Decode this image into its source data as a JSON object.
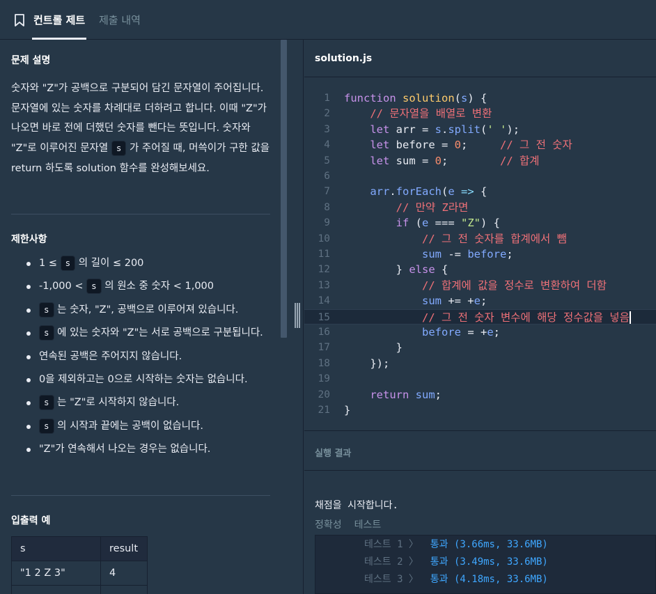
{
  "header": {
    "tab_active": "컨트롤 제트",
    "tab_inactive": "제출 내역"
  },
  "problem": {
    "title": "문제 설명",
    "desc_parts": [
      "숫자와 \"Z\"가 공백으로 구분되어 담긴 문자열이 주어집니다. 문자열에 있는 숫자를 차례대로 더하려고 합니다. 이때 \"Z\"가 나오면 바로 전에 더했던 숫자를 뺀다는 뜻입니다. 숫자와 \"Z\"로 이루어진 문자열 ",
      "s",
      " 가 주어질 때, 머쓱이가 구한 값을 return 하도록 solution 함수를 완성해보세요."
    ]
  },
  "constraints": {
    "title": "제한사항",
    "items": [
      {
        "pre": "1 ≤ ",
        "code": "s",
        "post": " 의 길이 ≤ 200"
      },
      {
        "pre": "-1,000 < ",
        "code": "s",
        "post": " 의 원소 중 숫자 < 1,000"
      },
      {
        "pre": "",
        "code": "s",
        "post": " 는 숫자, \"Z\", 공백으로 이루어져 있습니다."
      },
      {
        "pre": "",
        "code": "s",
        "post": " 에 있는 숫자와 \"Z\"는 서로 공백으로 구분됩니다."
      },
      {
        "pre": "연속된 공백은 주어지지 않습니다.",
        "code": "",
        "post": ""
      },
      {
        "pre": "0을 제외하고는 0으로 시작하는 숫자는 없습니다.",
        "code": "",
        "post": ""
      },
      {
        "pre": "",
        "code": "s",
        "post": " 는 \"Z\"로 시작하지 않습니다."
      },
      {
        "pre": "",
        "code": "s",
        "post": " 의 시작과 끝에는 공백이 없습니다."
      },
      {
        "pre": "\"Z\"가 연속해서 나오는 경우는 없습니다.",
        "code": "",
        "post": ""
      }
    ]
  },
  "io": {
    "title": "입출력 예",
    "headers": [
      "s",
      "result"
    ],
    "rows": [
      [
        "\"1 2 Z 3\"",
        "4"
      ]
    ]
  },
  "editor": {
    "filename": "solution.js",
    "line_numbers": [
      "1",
      "2",
      "3",
      "4",
      "5",
      "6",
      "7",
      "8",
      "9",
      "10",
      "11",
      "12",
      "13",
      "14",
      "15",
      "16",
      "17",
      "18",
      "19",
      "20",
      "21"
    ],
    "active_line": 15
  },
  "result": {
    "title": "실행 결과",
    "start_msg": "채점을 시작합니다.",
    "col_accuracy": "정확성",
    "col_test": "테스트",
    "tests": [
      {
        "label": "테스트 1 〉",
        "result": "통과 (3.66ms, 33.6MB)"
      },
      {
        "label": "테스트 2 〉",
        "result": "통과 (3.49ms, 33.6MB)"
      },
      {
        "label": "테스트 3 〉",
        "result": "통과 (4.18ms, 33.6MB)"
      }
    ]
  }
}
